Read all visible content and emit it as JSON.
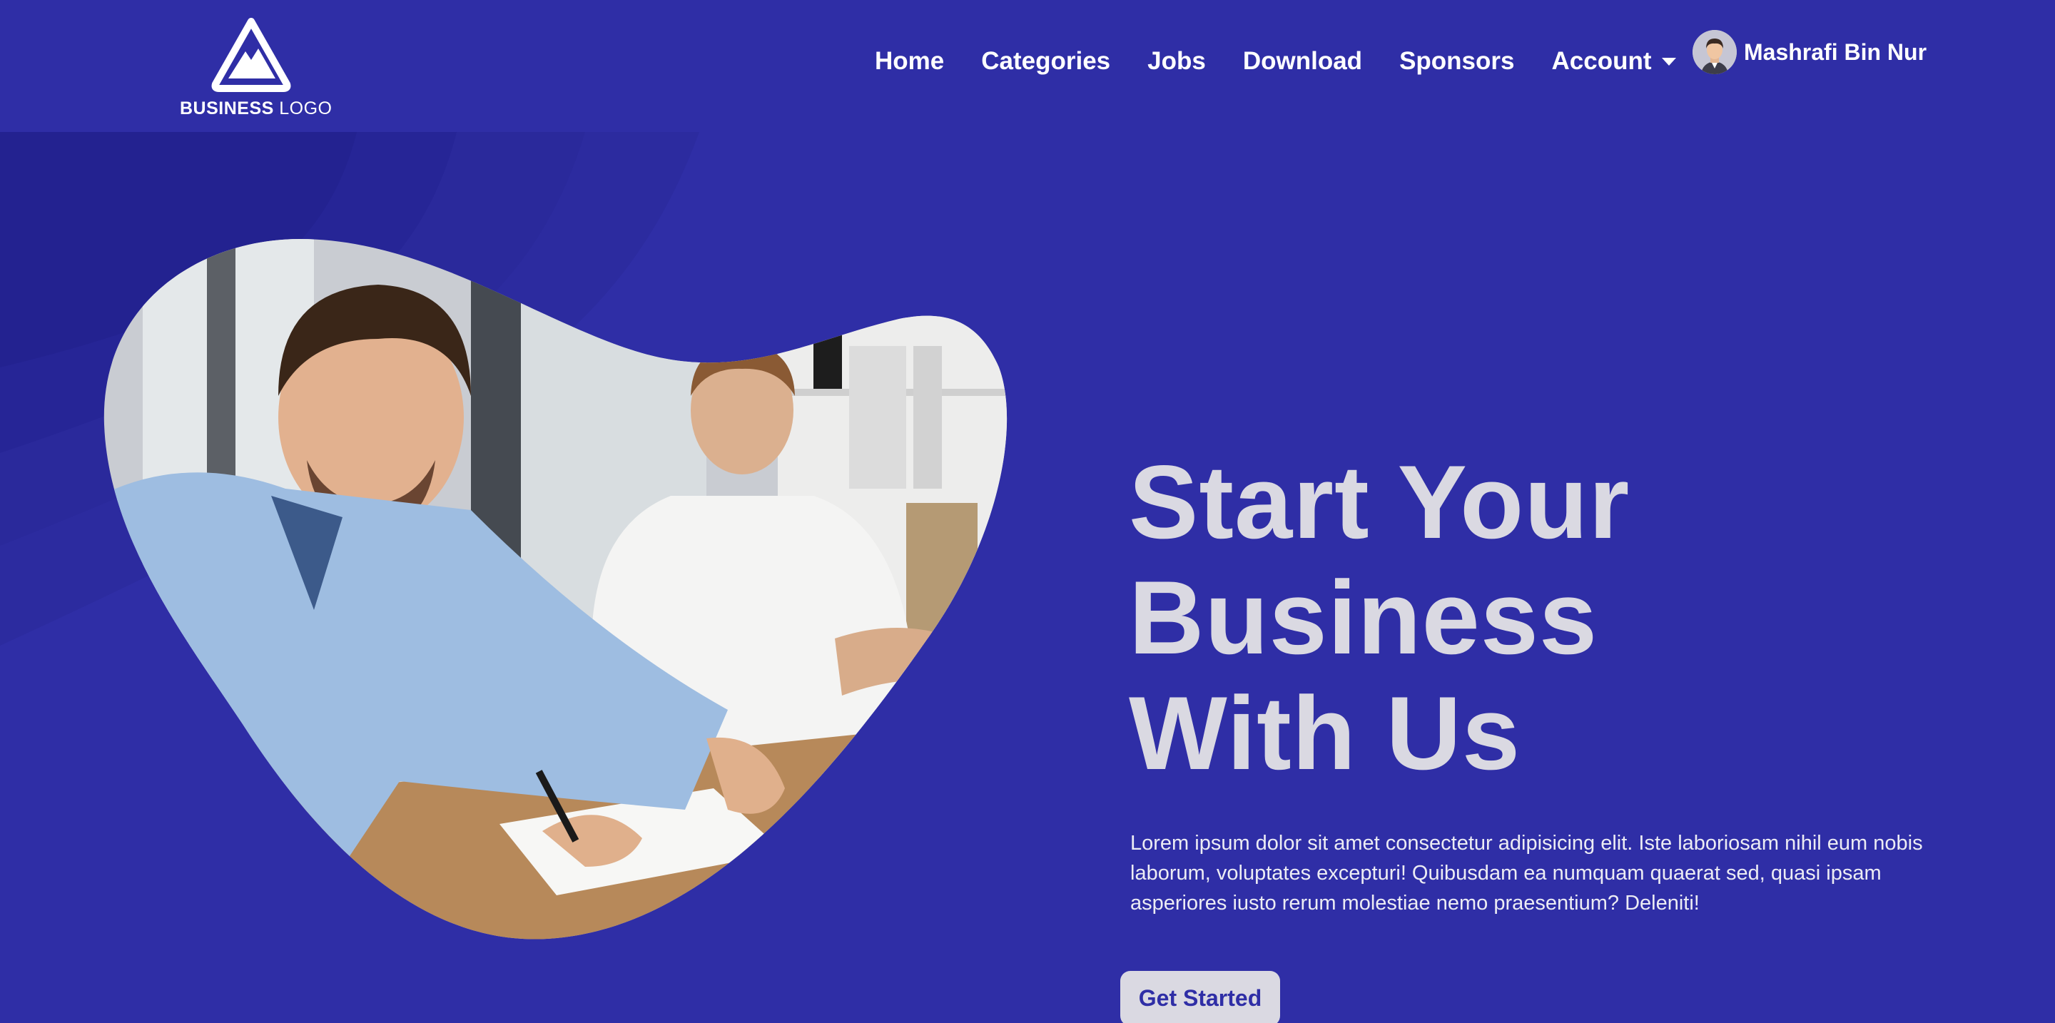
{
  "brand": {
    "logo_bold": "BUSINESS",
    "logo_light": "LOGO",
    "background": "#2f2ea6",
    "text_light": "#dad9e2"
  },
  "nav": {
    "items": [
      "Home",
      "Categories",
      "Jobs",
      "Download",
      "Sponsors"
    ],
    "account_label": "Account"
  },
  "user": {
    "name": "Mashrafi Bin Nur"
  },
  "hero": {
    "headline_lines": [
      "Start Your",
      "Business",
      "With Us"
    ],
    "description": "Lorem ipsum dolor sit amet consectetur adipisicing elit. Iste laboriosam nihil eum nobis laborum, voluptates excepturi! Quibusdam ea numquam quaerat sed, quasi ipsam asperiores iusto rerum molestiae nemo praesentium? Deleniti!",
    "cta_label": "Get Started"
  }
}
